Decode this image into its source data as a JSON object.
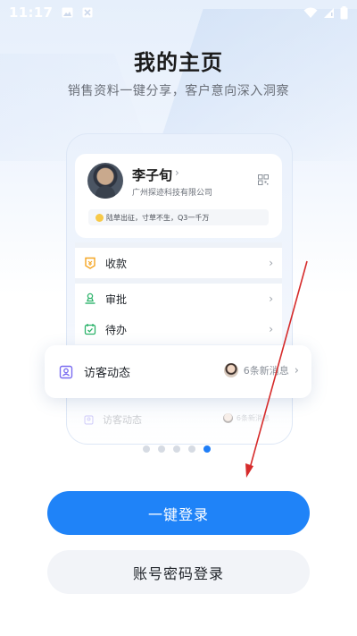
{
  "status_bar": {
    "time": "11:17",
    "left_icons": [
      "image-icon",
      "notification-icon"
    ],
    "right_icons": [
      "wifi-icon",
      "cellular-signal-icon",
      "battery-icon"
    ]
  },
  "header": {
    "title": "我的主页",
    "subtitle": "销售资料一键分享，客户意向深入洞察"
  },
  "profile": {
    "name": "李子旬",
    "company": "广州探迹科技有限公司",
    "motto": "陆草出征，寸草不生，Q3一千万"
  },
  "menu": [
    {
      "label": "收款",
      "icon": "payment-icon",
      "color": "#f5a623"
    },
    {
      "label": "审批",
      "icon": "approval-stamp-icon",
      "color": "#2db36b"
    },
    {
      "label": "待办",
      "icon": "calendar-check-icon",
      "color": "#2db36b"
    }
  ],
  "visitor": {
    "label": "访客动态",
    "count_text": "6条新消息",
    "icon": "visitor-badge-icon",
    "icon_color": "#7a6cf0"
  },
  "faded_row": {
    "label": "访客动态",
    "count_text": "6条新消息"
  },
  "carousel": {
    "page_count": 5,
    "active_index": 4
  },
  "buttons": {
    "primary": "一键登录",
    "secondary": "账号密码登录"
  },
  "colors": {
    "accent": "#1f83f8",
    "annotation_arrow": "#d62b2b"
  }
}
